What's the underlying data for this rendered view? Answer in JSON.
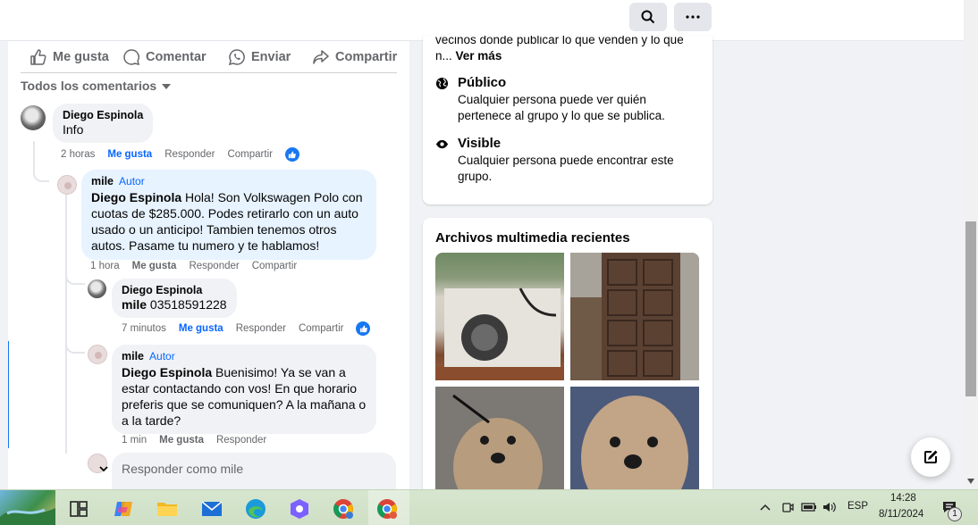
{
  "actions": {
    "like": "Me gusta",
    "comment": "Comentar",
    "send": "Enviar",
    "share": "Compartir"
  },
  "sort_label": "Todos los comentarios",
  "comments": [
    {
      "name": "Diego Espinola",
      "text": "Info",
      "time": "2 horas",
      "like": "Me gusta",
      "reply": "Responder",
      "share": "Compartir"
    },
    {
      "name": "mile",
      "badge": "Autor",
      "mention": "Diego Espinola",
      "text": " Hola! Son Volkswagen Polo con cuotas de $285.000. Podes retirarlo con un auto usado o un anticipo! Tambien tenemos otros autos. Pasame tu numero y te hablamos!",
      "time": "1 hora",
      "like": "Me gusta",
      "reply": "Responder",
      "share": "Compartir"
    },
    {
      "name": "Diego Espinola",
      "mention": "mile",
      "text": " 03518591228",
      "time": "7 minutos",
      "like": "Me gusta",
      "reply": "Responder",
      "share": "Compartir"
    },
    {
      "name": "mile",
      "badge": "Autor",
      "mention": "Diego Espinola",
      "text": " Buenisimo! Ya se van a estar contactando con vos! En que horario preferis que se comuniquen? A la mañana o a la tarde?",
      "time": "1 min",
      "like": "Me gusta",
      "reply": "Responder"
    }
  ],
  "reply_placeholder": "Responder como mile",
  "about": {
    "truncated_text": "vecinos donde publicar lo que venden y lo que",
    "truncated_text2": "n...",
    "see_more": "Ver más",
    "public_title": "Público",
    "public_desc": "Cualquier persona puede ver quién pertenece al grupo y lo que se publica.",
    "visible_title": "Visible",
    "visible_desc": "Cualquier persona puede encontrar este grupo."
  },
  "media": {
    "title": "Archivos multimedia recientes"
  },
  "taskbar": {
    "lang": "ESP",
    "time": "14:28",
    "date": "8/11/2024",
    "notif_count": "1"
  },
  "colors": {
    "accent": "#0866ff",
    "author_bubble": "#e7f3ff",
    "bubble": "#f0f2f5",
    "thread_highlight": "#1877f2"
  }
}
